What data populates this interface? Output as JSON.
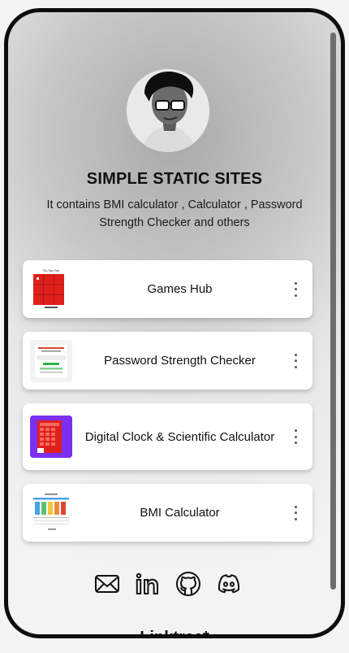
{
  "profile": {
    "title": "SIMPLE STATIC SITES",
    "description": "It contains BMI calculator , Calculator , Password Strength Checker and others"
  },
  "links": [
    {
      "label": "Games Hub",
      "thumb_caption": "Tic-Tac-Toe",
      "thumb_icon": "tic-tac-toe-thumbnail"
    },
    {
      "label": "Password Strength Checker",
      "thumb_icon": "password-checker-thumbnail"
    },
    {
      "label": "Digital Clock & Scientific Calculator",
      "thumb_icon": "calculator-thumbnail"
    },
    {
      "label": "BMI Calculator",
      "thumb_icon": "bmi-chart-thumbnail"
    }
  ],
  "socials": [
    {
      "icon": "email-icon"
    },
    {
      "icon": "linkedin-icon"
    },
    {
      "icon": "github-icon"
    },
    {
      "icon": "discord-icon"
    }
  ],
  "footer": {
    "brand": "Linktree*"
  },
  "colors": {
    "accent_red": "#e0201b",
    "purple": "#7b2ff0",
    "card_bg": "#ffffff",
    "frame": "#0d0d0d"
  }
}
